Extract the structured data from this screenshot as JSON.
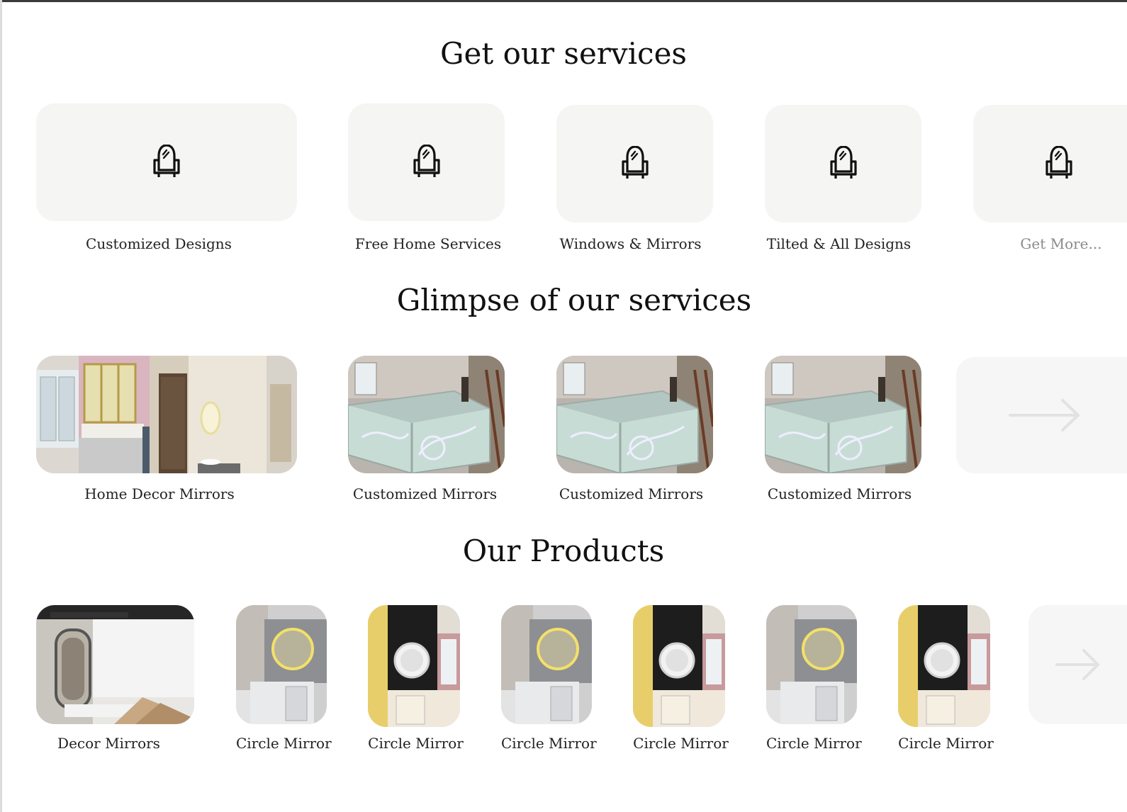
{
  "sections": {
    "services_title": "Get our services",
    "glimpse_title": "Glimpse of our services",
    "products_title": "Our Products"
  },
  "services": [
    {
      "label": "Customized Designs",
      "icon": "mirror-stand-icon"
    },
    {
      "label": "Free Home Services",
      "icon": "mirror-stand-icon"
    },
    {
      "label": "Windows & Mirrors",
      "icon": "mirror-stand-icon"
    },
    {
      "label": "Tilted & All Designs",
      "icon": "mirror-stand-icon"
    },
    {
      "label": "Get More...",
      "icon": "mirror-stand-icon"
    }
  ],
  "glimpse": [
    {
      "label": "Home Decor Mirrors"
    },
    {
      "label": "Customized Mirrors"
    },
    {
      "label": "Customized Mirrors"
    },
    {
      "label": "Customized Mirrors"
    }
  ],
  "products": [
    {
      "label": "Decor Mirrors"
    },
    {
      "label": "Circle Mirror"
    },
    {
      "label": "Circle Mirror"
    },
    {
      "label": "Circle Mirror"
    },
    {
      "label": "Circle Mirror"
    },
    {
      "label": "Circle Mirror"
    },
    {
      "label": "Circle Mirror"
    }
  ],
  "colors": {
    "card_bg": "#f5f5f3",
    "text": "#111111",
    "muted": "#8a8a8a"
  }
}
